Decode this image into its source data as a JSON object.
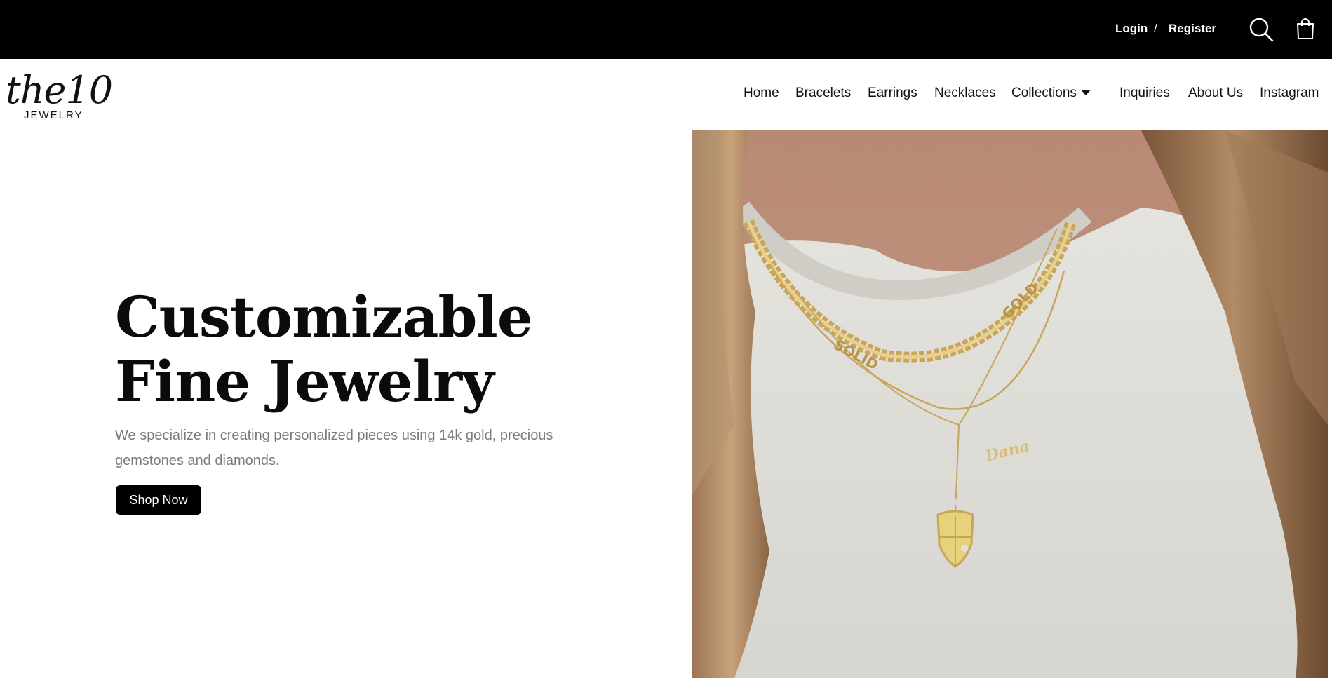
{
  "topbar": {
    "login_label": "Login",
    "separator": "/",
    "register_label": "Register",
    "icons": [
      "search-icon",
      "cart-icon"
    ]
  },
  "header": {
    "logo": {
      "wordmark": "the10",
      "subword": "JEWELRY"
    },
    "nav": [
      {
        "label": "Home"
      },
      {
        "label": "Bracelets"
      },
      {
        "label": "Earrings"
      },
      {
        "label": "Necklaces"
      },
      {
        "label": "Collections",
        "has_dropdown": true
      },
      {
        "label": "Inquiries"
      },
      {
        "label": "About Us"
      },
      {
        "label": "Instagram"
      }
    ]
  },
  "hero": {
    "title": "Customizable Fine Jewelry",
    "subtitle": "We specialize in creating personalized pieces using 14k gold, precious gemstones and diamonds.",
    "cta_label": "Shop Now",
    "image_alt": "Model wearing layered gold necklaces with SOLID GOLD chain, Dana nameplate and crest pendant",
    "image_engravings": [
      "SOLID",
      "GOLD",
      "Dana"
    ]
  },
  "colors": {
    "topbar_bg": "#000000",
    "button_bg": "#000000",
    "subtitle_text": "#7a7a7a"
  }
}
